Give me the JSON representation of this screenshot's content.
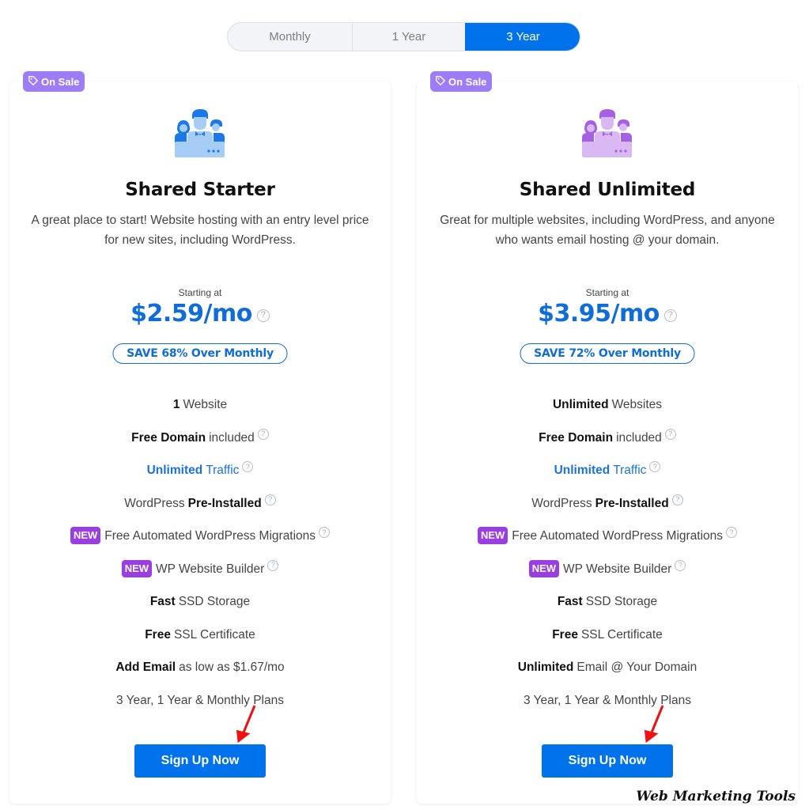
{
  "billing_toggle": {
    "options": [
      "Monthly",
      "1 Year",
      "3 Year"
    ],
    "selected": "3 Year"
  },
  "colors": {
    "accent_blue": "#0073ec",
    "price_blue": "#0e6dd8",
    "sale_badge": "#9c7df5",
    "new_badge": "#9b3ee0"
  },
  "plans": [
    {
      "badge": "On Sale",
      "icon": "team-users-icon",
      "icon_color": "blue",
      "title": "Shared Starter",
      "description": "A great place to start! Website hosting with an entry level price for new sites, including WordPress.",
      "starting_label": "Starting at",
      "price": "$2.59/mo",
      "save_label": "SAVE 68% Over Monthly",
      "features": [
        {
          "bold": "1",
          "text": "Website",
          "help": false
        },
        {
          "bold": "Free Domain",
          "text": "included",
          "help": true
        },
        {
          "bold": "Unlimited",
          "text": "Traffic",
          "help": true,
          "highlight": true
        },
        {
          "pre": "WordPress",
          "bold": "Pre-Installed",
          "help": true
        },
        {
          "new": "NEW",
          "text": "Free Automated WordPress Migrations",
          "help": true
        },
        {
          "new": "NEW",
          "text": "WP Website Builder",
          "help": true
        },
        {
          "bold": "Fast",
          "text": "SSD Storage",
          "help": false
        },
        {
          "bold": "Free",
          "text": "SSL Certificate",
          "help": false
        },
        {
          "bold": "Add Email",
          "text": "as low as $1.67/mo",
          "help": false
        },
        {
          "text": "3 Year, 1 Year & Monthly Plans",
          "help": false
        }
      ],
      "cta": "Sign Up Now"
    },
    {
      "badge": "On Sale",
      "icon": "team-users-icon",
      "icon_color": "purple",
      "title": "Shared Unlimited",
      "description": "Great for multiple websites, including WordPress, and anyone who wants email hosting @ your domain.",
      "starting_label": "Starting at",
      "price": "$3.95/mo",
      "save_label": "SAVE 72% Over Monthly",
      "features": [
        {
          "bold": "Unlimited",
          "text": "Websites",
          "help": false
        },
        {
          "bold": "Free Domain",
          "text": "included",
          "help": true
        },
        {
          "bold": "Unlimited",
          "text": "Traffic",
          "help": true,
          "highlight": true
        },
        {
          "pre": "WordPress",
          "bold": "Pre-Installed",
          "help": true
        },
        {
          "new": "NEW",
          "text": "Free Automated WordPress Migrations",
          "help": true
        },
        {
          "new": "NEW",
          "text": "WP Website Builder",
          "help": true
        },
        {
          "bold": "Fast",
          "text": "SSD Storage",
          "help": false
        },
        {
          "bold": "Free",
          "text": "SSL Certificate",
          "help": false
        },
        {
          "bold": "Unlimited",
          "text": "Email @ Your Domain",
          "help": false
        },
        {
          "text": "3 Year, 1 Year & Monthly Plans",
          "help": false
        }
      ],
      "cta": "Sign Up Now"
    }
  ],
  "help_glyph": "?",
  "watermark": "Web Marketing Tools"
}
